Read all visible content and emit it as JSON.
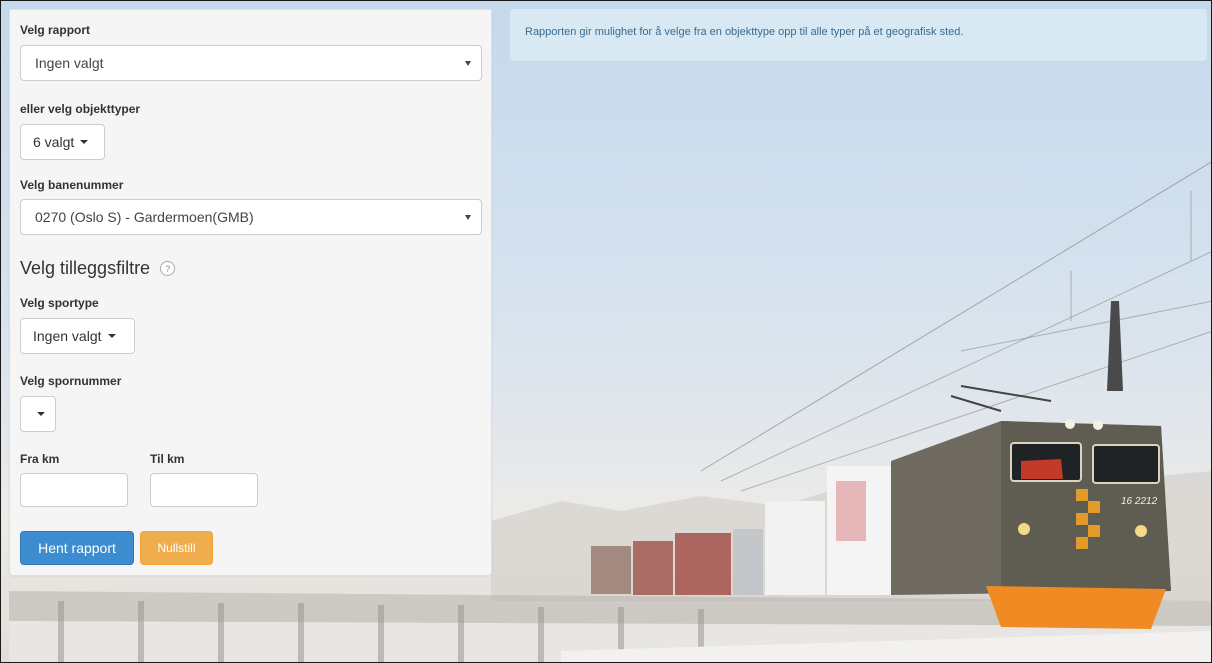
{
  "report": {
    "label": "Velg rapport",
    "value": "Ingen valgt"
  },
  "object_types": {
    "label": "eller velg objekttyper",
    "value": "6 valgt"
  },
  "line_number": {
    "label": "Velg banenummer",
    "value": "0270 (Oslo S) - Gardermoen(GMB)"
  },
  "extra_filters": {
    "heading": "Velg tilleggsfiltre",
    "help": "?"
  },
  "track_type": {
    "label": "Velg sportype",
    "value": "Ingen valgt"
  },
  "track_number": {
    "label": "Velg spornummer",
    "value": ""
  },
  "from_km": {
    "label": "Fra km",
    "value": ""
  },
  "to_km": {
    "label": "Til km",
    "value": ""
  },
  "actions": {
    "fetch": "Hent rapport",
    "reset": "Nullstill"
  },
  "info": {
    "text": "Rapporten gir mulighet for å velge fra en objekttype opp til alle typer på et geografisk sted."
  },
  "locomotive": {
    "number": "16 2212"
  },
  "colors": {
    "primary": "#3c8ccf",
    "warning": "#f0ad4e",
    "panel": "#f5f5f5",
    "info_bg": "#d9eaf4"
  }
}
